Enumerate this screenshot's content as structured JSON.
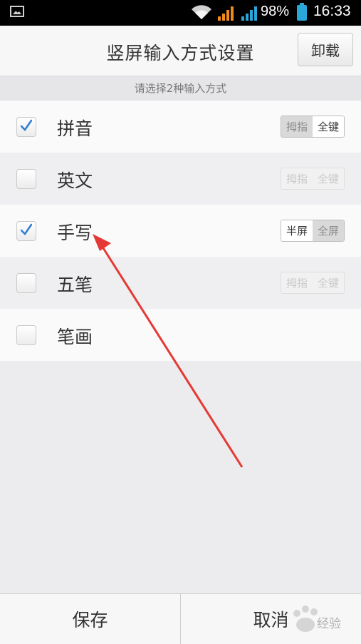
{
  "status_bar": {
    "battery_percent": "98%",
    "time": "16:33",
    "icons": [
      "image-icon",
      "wifi-icon",
      "signal-icon",
      "signal-icon",
      "battery-icon"
    ]
  },
  "header": {
    "title": "竖屏输入方式设置",
    "uninstall_label": "卸载"
  },
  "subheader": "请选择2种输入方式",
  "methods": [
    {
      "label": "拼音",
      "checked": true,
      "options": [
        "拇指",
        "全键"
      ],
      "selected": 1,
      "enabled": true
    },
    {
      "label": "英文",
      "checked": false,
      "options": [
        "拇指",
        "全键"
      ],
      "selected": null,
      "enabled": false
    },
    {
      "label": "手写",
      "checked": true,
      "options": [
        "半屏",
        "全屏"
      ],
      "selected": 0,
      "enabled": true
    },
    {
      "label": "五笔",
      "checked": false,
      "options": [
        "拇指",
        "全键"
      ],
      "selected": null,
      "enabled": false
    },
    {
      "label": "笔画",
      "checked": false,
      "options": [],
      "selected": null,
      "enabled": false
    }
  ],
  "footer": {
    "save_label": "保存",
    "cancel_label": "取消"
  },
  "watermark_text": "经验",
  "colors": {
    "check": "#2f7fd6",
    "arrow": "#e53935",
    "battery": "#2aa6d8",
    "signal_orange": "#f08a1c",
    "signal_blue": "#2aa6d8"
  }
}
